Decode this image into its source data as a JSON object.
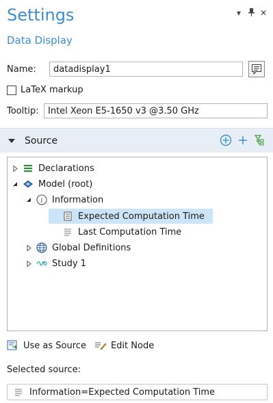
{
  "header": {
    "title": "Settings",
    "subtitle": "Data Display"
  },
  "name_field": {
    "label": "Name:",
    "value": "datadisplay1"
  },
  "latex": {
    "label": "LaTeX markup",
    "checked": false
  },
  "tooltip_field": {
    "label": "Tooltip:",
    "value": "Intel Xeon E5-1650 v3 @3.50 GHz"
  },
  "source_section": {
    "title": "Source"
  },
  "tree": {
    "declarations": "Declarations",
    "model": "Model (root)",
    "information": "Information",
    "expected": "Expected Computation Time",
    "last": "Last Computation Time",
    "global": "Global Definitions",
    "study": "Study 1"
  },
  "buttons": {
    "use_as_source": "Use as Source",
    "edit_node": "Edit Node"
  },
  "selected_source": {
    "label": "Selected source:",
    "value": "Information=Expected Computation Time"
  },
  "colors": {
    "accent": "#3c8ed1",
    "section_bg": "#e7eef6",
    "selection": "#cce4f7"
  }
}
